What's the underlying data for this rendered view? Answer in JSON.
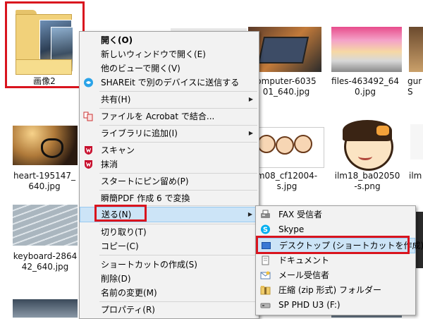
{
  "files": [
    {
      "name": "画像2"
    },
    {
      "name": "omputer-6035\n01_640.jpg"
    },
    {
      "name": "files-463492_64\n0.jpg"
    },
    {
      "name": "gur\nS"
    },
    {
      "name": "heart-195147_\n640.jpg"
    },
    {
      "name": "m08_cf12004-\ns.jpg"
    },
    {
      "name": "ilm18_ba02050\n-s.png"
    },
    {
      "name": "ilm"
    },
    {
      "name": "keyboard-2864\n42_640.jpg"
    }
  ],
  "context_menu": {
    "items": [
      {
        "label": "開く(O)"
      },
      {
        "label": "新しいウィンドウで開く(E)"
      },
      {
        "label": "他のビューで開く(V)"
      },
      {
        "label": "SHAREit で別のデバイスに送信する"
      },
      {
        "label": "共有(H)"
      },
      {
        "label": "ファイルを Acrobat で結合..."
      },
      {
        "label": "ライブラリに追加(I)"
      },
      {
        "label": "スキャン"
      },
      {
        "label": "抹消"
      },
      {
        "label": "スタートにピン留め(P)"
      },
      {
        "label": "瞬簡PDF 作成 6 で変換"
      },
      {
        "label": "送る(N)"
      },
      {
        "label": "切り取り(T)"
      },
      {
        "label": "コピー(C)"
      },
      {
        "label": "ショートカットの作成(S)"
      },
      {
        "label": "削除(D)"
      },
      {
        "label": "名前の変更(M)"
      },
      {
        "label": "プロパティ(R)"
      }
    ]
  },
  "send_to_menu": {
    "items": [
      {
        "label": "FAX 受信者",
        "icon": "fax-icon"
      },
      {
        "label": "Skype",
        "icon": "skype-icon"
      },
      {
        "label": "デスクトップ (ショートカットを作成)",
        "icon": "desktop-icon"
      },
      {
        "label": "ドキュメント",
        "icon": "documents-icon"
      },
      {
        "label": "メール受信者",
        "icon": "mail-icon"
      },
      {
        "label": "圧縮 (zip 形式) フォルダー",
        "icon": "zip-folder-icon"
      },
      {
        "label": "SP PHD U3 (F:)",
        "icon": "drive-icon"
      }
    ]
  },
  "colors": {
    "highlight_border": "#d9141e",
    "menu_hover": "#cce4f7"
  }
}
